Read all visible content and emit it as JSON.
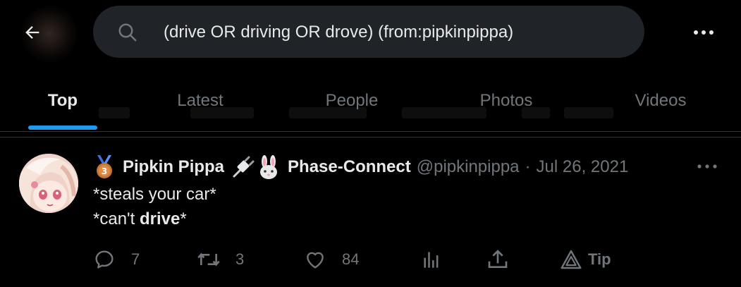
{
  "search": {
    "query": "(drive OR driving OR drove) (from:pipkinpippa)"
  },
  "tabs": [
    {
      "label": "Top",
      "active": true
    },
    {
      "label": "Latest",
      "active": false
    },
    {
      "label": "People",
      "active": false
    },
    {
      "label": "Photos",
      "active": false
    },
    {
      "label": "Videos",
      "active": false
    }
  ],
  "tweet": {
    "name": "Pipkin Pippa",
    "name_affiliation": "Phase-Connect",
    "handle": "@pipkinpippa",
    "separator": "·",
    "date": "Jul 26, 2021",
    "line1": "*steals your car*",
    "line2_prefix": "*can't ",
    "line2_bold": "drive",
    "line2_suffix": "*",
    "actions": {
      "reply_count": "7",
      "retweet_count": "3",
      "like_count": "84",
      "tip_label": "Tip"
    }
  },
  "colors": {
    "background": "#000000",
    "accent": "#1d9bf0",
    "text_primary": "#e7e9ea",
    "text_secondary": "#71767b",
    "search_bg": "#202327",
    "divider": "#2f3336"
  },
  "icons": [
    "back-arrow-icon",
    "search-icon",
    "more-icon",
    "medal-icon",
    "plug-icon",
    "rabbit-icon",
    "reply-icon",
    "retweet-icon",
    "like-icon",
    "analytics-icon",
    "share-icon",
    "tip-icon"
  ]
}
